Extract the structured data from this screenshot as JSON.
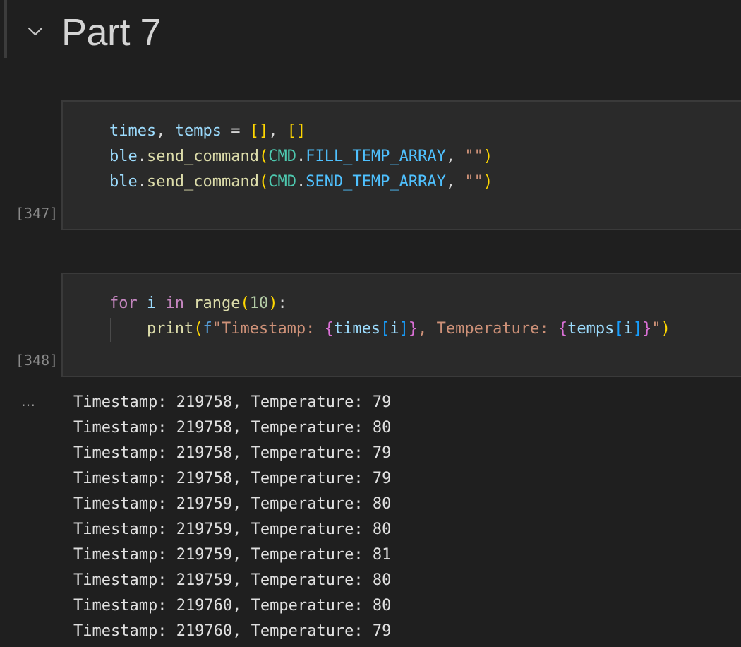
{
  "heading": {
    "title": "Part 7"
  },
  "cells": [
    {
      "execution_count": "[347]",
      "lines": [
        "times, temps = [], []",
        "ble.send_command(CMD.FILL_TEMP_ARRAY, \"\")",
        "ble.send_command(CMD.SEND_TEMP_ARRAY, \"\")"
      ]
    },
    {
      "execution_count": "[348]",
      "lines": [
        "for i in range(10):",
        "    print(f\"Timestamp: {times[i]}, Temperature: {temps[i]}\")"
      ]
    }
  ],
  "output": {
    "toggle_label": "…",
    "lines": [
      "Timestamp: 219758, Temperature: 79",
      "Timestamp: 219758, Temperature: 80",
      "Timestamp: 219758, Temperature: 79",
      "Timestamp: 219758, Temperature: 79",
      "Timestamp: 219759, Temperature: 80",
      "Timestamp: 219759, Temperature: 80",
      "Timestamp: 219759, Temperature: 81",
      "Timestamp: 219759, Temperature: 80",
      "Timestamp: 219760, Temperature: 80",
      "Timestamp: 219760, Temperature: 79"
    ]
  },
  "icons": {
    "collapse": "chevron-down-icon"
  }
}
